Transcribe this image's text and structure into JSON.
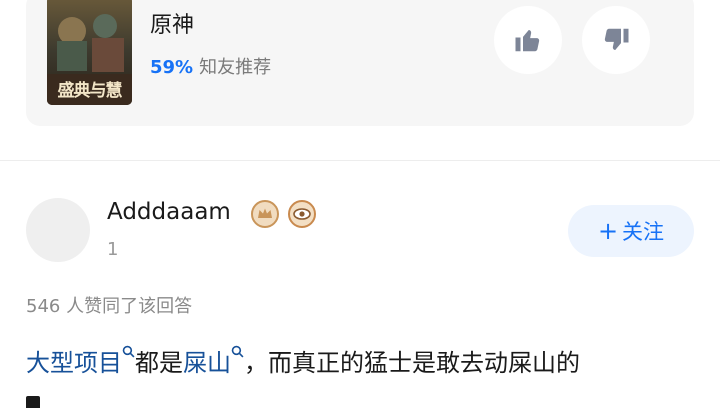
{
  "game_card": {
    "title": "原神",
    "cover_text": "盛典与慧",
    "rating_percent": "59%",
    "rating_label": "知友推荐",
    "thumbs_up_icon": "thumbs-up-icon",
    "thumbs_down_icon": "thumbs-down-icon"
  },
  "author": {
    "name": "Adddaaam",
    "sub_text": "1",
    "badges": [
      "crown-badge-icon",
      "eye-badge-icon"
    ],
    "badge_colors": {
      "crown": "#c9955a",
      "eye": "#c98a4e"
    }
  },
  "follow_button": {
    "plus": "+",
    "label": "关注"
  },
  "upvotes": {
    "text": "546 人赞同了该回答"
  },
  "answer": {
    "link1": "大型项目",
    "text1": "都是",
    "link2": "屎山",
    "text2": "，而真正的猛士是敢去动屎山的"
  },
  "colors": {
    "accent": "#1772f6",
    "link": "#175199",
    "card_bg": "#f6f6f6",
    "follow_bg": "#edf4fe"
  }
}
